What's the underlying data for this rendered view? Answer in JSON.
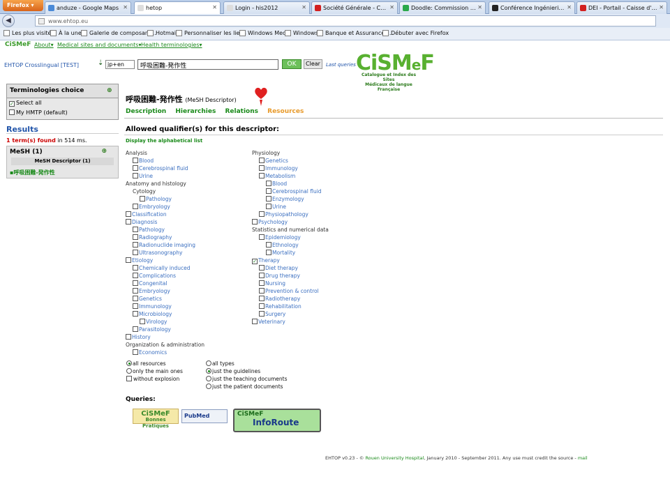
{
  "browser": {
    "firefox_label": "Firefox ▾",
    "tabs": [
      {
        "label": "anduze - Google Maps",
        "color": "#4a8ad8"
      },
      {
        "label": "hetop",
        "color": "#dddddd"
      },
      {
        "label": "Login - his2012",
        "color": "#dddddd"
      },
      {
        "label": "Société Générale - Comptes ...",
        "color": "#d22020"
      },
      {
        "label": "Doodle: Commission techno",
        "color": "#2aa84a"
      },
      {
        "label": "Conférence Ingénierie des C...",
        "color": "#222222"
      },
      {
        "label": "DEI - Portail - Caisse d'Eparg...",
        "color": "#d22020"
      }
    ],
    "url": "www.ehtop.eu",
    "bookmarks": [
      "Les plus visités",
      "À la une",
      "Galerie de composant...",
      "Hotmail",
      "Personnaliser les liens",
      "Windows Media",
      "Windows",
      "Banque et Assurances...",
      "Débuter avec Firefox"
    ]
  },
  "site": {
    "brand_small": "CiSMeF",
    "menu": [
      "About▾",
      "Medical sites and documents▾",
      "Health terminologies▾"
    ],
    "app_title": "EHTOP Crosslingual [TEST]",
    "lang": "jp+en",
    "query": "呼吸困難-発作性",
    "ok_label": "OK",
    "clear_label": "Clear",
    "last_queries": "Last queries",
    "logo_main": "CiSM",
    "logo_e": "e",
    "logo_end": "F",
    "logo_sub1": "Catalogue et Index des Sites",
    "logo_sub2": "Médicaux de langue Française"
  },
  "left": {
    "terminologies_title": "Terminologies choice",
    "select_all": "Select all",
    "my_hmtp": "My HMTP (default)",
    "results_title": "Results",
    "count_term": "1 term(s) found",
    "count_time": " in 514 ms.",
    "mesh_title": "MeSH (1)",
    "mesh_sub": "MeSH Descriptor (1)",
    "mesh_term": "呼吸困難-発作性"
  },
  "main": {
    "descriptor": "呼吸困難-発作性",
    "descriptor_type": "(MeSH Descriptor)",
    "tabs": [
      "Description",
      "Hierarchies",
      "Relations",
      "Resources"
    ],
    "allowed_title": "Allowed qualifier(s) for this descriptor:",
    "display_list": "Display the alphabetical list",
    "qualifiers_left": [
      {
        "label": "Analysis",
        "level": 0,
        "head": true
      },
      {
        "label": "Blood",
        "level": 1
      },
      {
        "label": "Cerebrospinal fluid",
        "level": 1
      },
      {
        "label": "Urine",
        "level": 1
      },
      {
        "label": "Anatomy and histology",
        "level": 0,
        "head": true
      },
      {
        "label": "Cytology",
        "level": 1,
        "head": true
      },
      {
        "label": "Pathology",
        "level": 2
      },
      {
        "label": "Embryology",
        "level": 1
      },
      {
        "label": "Classification",
        "level": 0
      },
      {
        "label": "Diagnosis",
        "level": 0
      },
      {
        "label": "Pathology",
        "level": 1
      },
      {
        "label": "Radiography",
        "level": 1
      },
      {
        "label": "Radionuclide imaging",
        "level": 1
      },
      {
        "label": "Ultrasonography",
        "level": 1
      },
      {
        "label": "Etiology",
        "level": 0
      },
      {
        "label": "Chemically induced",
        "level": 1
      },
      {
        "label": "Complications",
        "level": 1
      },
      {
        "label": "Congenital",
        "level": 1
      },
      {
        "label": "Embryology",
        "level": 1
      },
      {
        "label": "Genetics",
        "level": 1
      },
      {
        "label": "Immunology",
        "level": 1
      },
      {
        "label": "Microbiology",
        "level": 1
      },
      {
        "label": "Virology",
        "level": 2
      },
      {
        "label": "Parasitology",
        "level": 1
      },
      {
        "label": "History",
        "level": 0
      },
      {
        "label": "Organization & administration",
        "level": 0,
        "head": true
      },
      {
        "label": "Economics",
        "level": 1
      }
    ],
    "qualifiers_right": [
      {
        "label": "Physiology",
        "level": 0,
        "head": true
      },
      {
        "label": "Genetics",
        "level": 1
      },
      {
        "label": "Immunology",
        "level": 1
      },
      {
        "label": "Metabolism",
        "level": 1
      },
      {
        "label": "Blood",
        "level": 2
      },
      {
        "label": "Cerebrospinal fluid",
        "level": 2
      },
      {
        "label": "Enzymology",
        "level": 2
      },
      {
        "label": "Urine",
        "level": 2
      },
      {
        "label": "Physiopathology",
        "level": 1
      },
      {
        "label": "Psychology",
        "level": 0
      },
      {
        "label": "Statistics and numerical data",
        "level": 0,
        "head": true
      },
      {
        "label": "Epidemiology",
        "level": 1
      },
      {
        "label": "Ethnology",
        "level": 2
      },
      {
        "label": "Mortality",
        "level": 2
      },
      {
        "label": "Therapy",
        "level": 0,
        "checked": true
      },
      {
        "label": "Diet therapy",
        "level": 1
      },
      {
        "label": "Drug therapy",
        "level": 1
      },
      {
        "label": "Nursing",
        "level": 1
      },
      {
        "label": "Prevention & control",
        "level": 1
      },
      {
        "label": "Radiotherapy",
        "level": 1
      },
      {
        "label": "Rehabilitation",
        "level": 1
      },
      {
        "label": "Surgery",
        "level": 1
      },
      {
        "label": "Veterinary",
        "level": 0
      }
    ],
    "scope_options": [
      {
        "label": "all resources",
        "type": "radio",
        "on": true
      },
      {
        "label": "only the main ones",
        "type": "radio",
        "on": false
      },
      {
        "label": "without explosion",
        "type": "check",
        "on": false
      }
    ],
    "type_options": [
      {
        "label": "all types",
        "on": false
      },
      {
        "label": "just the guidelines",
        "on": true
      },
      {
        "label": "just the teaching documents",
        "on": false
      },
      {
        "label": "just the patient documents",
        "on": false
      }
    ],
    "queries_label": "Queries:",
    "logo_bp_top": "CiSMeF",
    "logo_bp_bottom": "Bonnes Pratiques",
    "logo_pubmed": "PubMed",
    "logo_ir_brand": "CiSMeF",
    "logo_ir_name": "InfoRoute"
  },
  "footer": {
    "text": "EHTOP v0.23 - © ",
    "org": "Rouen University Hospital",
    "rest": ", January 2010 - September 2011. Any use must credit the source - ",
    "mail": "mail"
  }
}
